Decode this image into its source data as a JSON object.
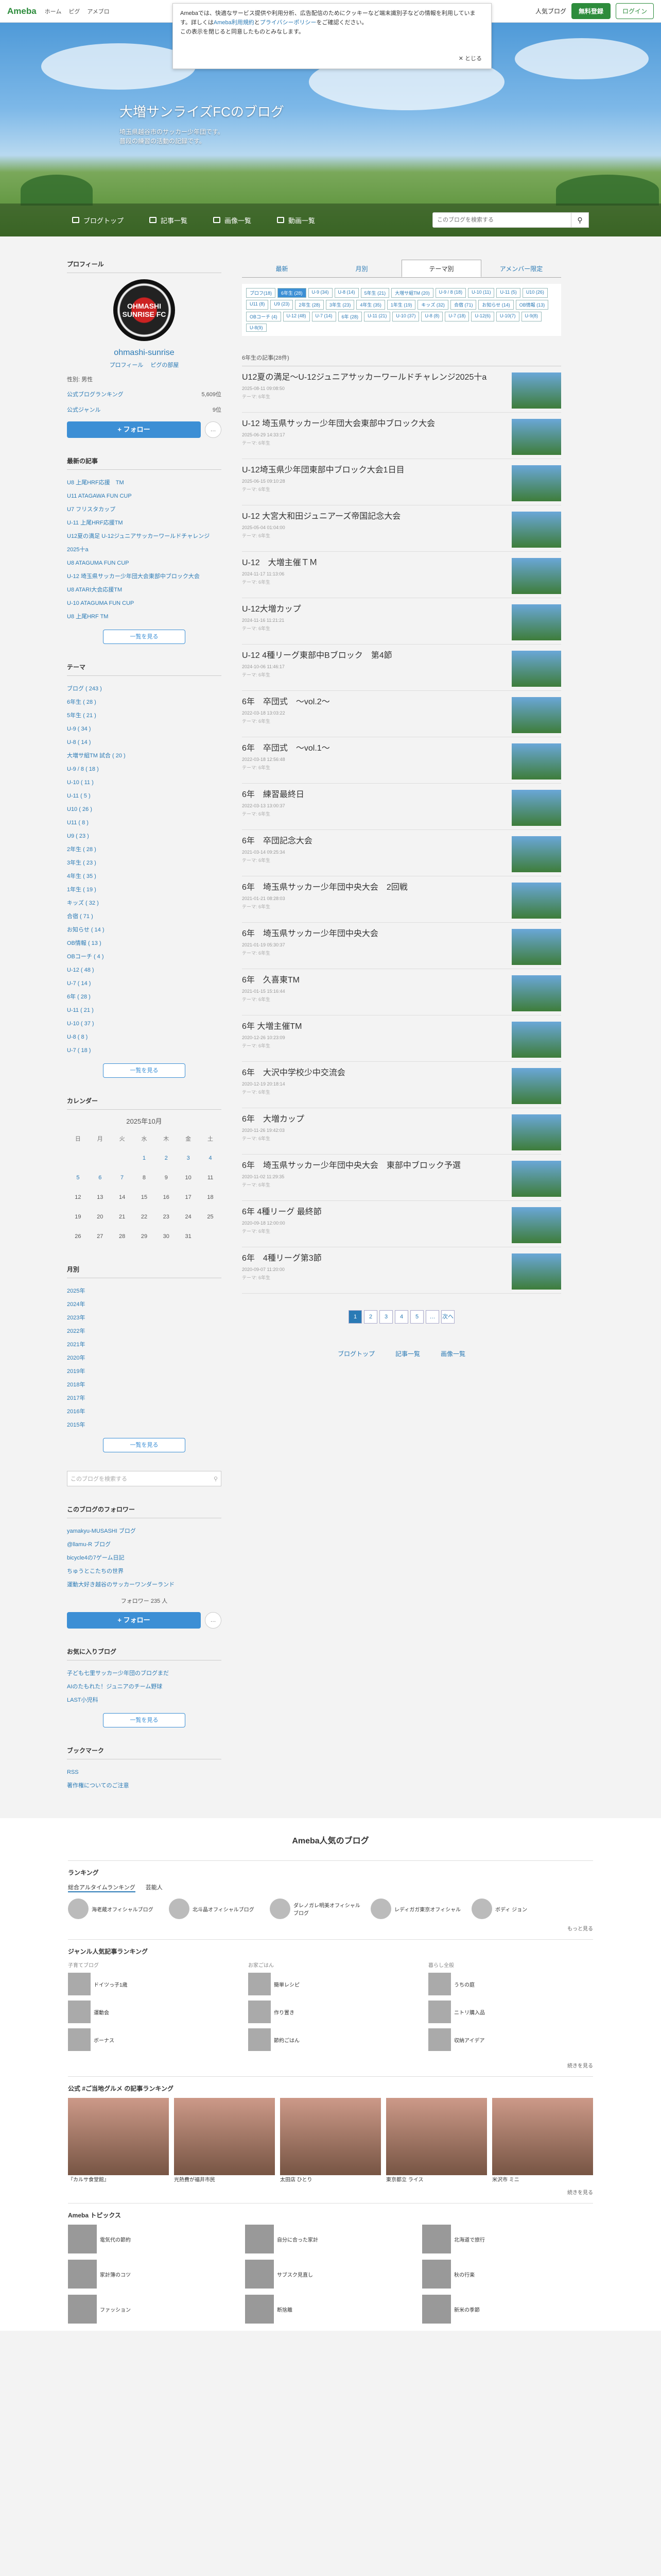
{
  "topbar": {
    "logo": "Ameba",
    "nav": [
      "ホーム",
      "ピグ",
      "アメブロ"
    ],
    "right_icon": "人気ブログ",
    "register": "無料登録",
    "login": "ログイン"
  },
  "notice": {
    "text1": "Amebaでは、快適なサービス提供や利用分析、広告配信のためにクッキーなど端末識別子などの情報を利用しています。詳しくは",
    "link1": "Ameba利用規約",
    "mid": "と",
    "link2": "プライバシーポリシー",
    "text2": "をご確認ください。",
    "text3": "この表示を閉じると同意したものとみなします。",
    "close": "✕ とじる"
  },
  "hero": {
    "title": "大増サンライズFCのブログ",
    "desc1": "埼玉県越谷市のサッカー少年団です。",
    "desc2": "普段の練習の活動の記録です。"
  },
  "gnav": {
    "items": [
      "ブログトップ",
      "記事一覧",
      "画像一覧",
      "動画一覧"
    ],
    "search_placeholder": "このブログを検索する"
  },
  "profile": {
    "title": "プロフィール",
    "avatar_text": "OHMASHI\nSUNRISE FC",
    "name": "ohmashi-sunrise",
    "link1": "プロフィール",
    "link2": "ピグの部屋",
    "info": "性別: 男性",
    "rank_label1": "公式ブログランキング",
    "rank_label2": "公式ジャンル",
    "rank_v1": "5,609位",
    "rank_v2": "9位",
    "follow": "+ フォロー"
  },
  "recent": {
    "title": "最新の記事",
    "items": [
      "U8 上尾HRF応援　TM",
      "U11 ATAGAWA FUN CUP",
      "U7 フリスタカップ",
      "U-11 上尾HRF応援TM",
      "U12夏の満足 U-12ジュニアサッカーワールドチャレンジ2025十a",
      "U8 ATAGUMA FUN CUP",
      "U-12 埼玉県サッカー少年団大会東部中ブロック大会",
      "U8 ATARI大会応援TM",
      "U-10 ATAGUMA FUN CUP",
      "U8 上尾HRF TM"
    ],
    "more": "一覧を見る"
  },
  "themes": {
    "title": "テーマ",
    "items": [
      "ブログ ( 243 )",
      "6年生 ( 28 )",
      "5年生 ( 21 )",
      "U-9 ( 34 )",
      "U-8 ( 14 )",
      "大増サ組TM 試合 ( 20 )",
      "U-9 / 8 ( 18 )",
      "U-10 ( 11 )",
      "U-11 ( 5 )",
      "U10 ( 26 )",
      "U11 ( 8 )",
      "U9 ( 23 )",
      "2年生 ( 28 )",
      "3年生 ( 23 )",
      "4年生 ( 35 )",
      "1年生 ( 19 )",
      "キッズ ( 32 )",
      "合宿 ( 71 )",
      "お知らせ ( 14 )",
      "OB情報 ( 13 )",
      "OBコーチ ( 4 )",
      "U-12 ( 48 )",
      "U-7 ( 14 )",
      "6年 ( 28 )",
      "U-11 ( 21 )",
      "U-10 ( 37 )",
      "U-8 ( 8 )",
      "U-7 ( 18 )"
    ],
    "more": "一覧を見る"
  },
  "calendar": {
    "title": "カレンダー",
    "month": "2025年10月",
    "week": [
      "日",
      "月",
      "火",
      "水",
      "木",
      "金",
      "土"
    ],
    "rows": [
      [
        "",
        "",
        "",
        "1",
        "2",
        "3",
        "4"
      ],
      [
        "5",
        "6",
        "7",
        "8",
        "9",
        "10",
        "11"
      ],
      [
        "12",
        "13",
        "14",
        "15",
        "16",
        "17",
        "18"
      ],
      [
        "19",
        "20",
        "21",
        "22",
        "23",
        "24",
        "25"
      ],
      [
        "26",
        "27",
        "28",
        "29",
        "30",
        "31",
        ""
      ]
    ]
  },
  "archive": {
    "title": "月別",
    "items": [
      "2025年",
      "2024年",
      "2023年",
      "2022年",
      "2021年",
      "2020年",
      "2019年",
      "2018年",
      "2017年",
      "2016年",
      "2015年"
    ],
    "more": "一覧を見る"
  },
  "search": {
    "placeholder": "このブログを検索する"
  },
  "following": {
    "title": "このブログのフォロワー",
    "items": [
      "yamakyu-MUSASHI ブログ",
      "@llamu-R ブログ",
      "bicycle4の7ゲーム日記",
      "ちゅうとこたちの世界",
      "運動大好き越谷のサッカーワンダーランド"
    ],
    "count": "フォロワー 235 人",
    "follow": "+ フォロー"
  },
  "favorite": {
    "title": "お気に入りブログ",
    "items": [
      "子ども七里サッカー少年団のブログまだ",
      "AIのたもれた！ジュニアのチーム野球",
      "LAST小児科"
    ],
    "more": "一覧を見る"
  },
  "bookmark": {
    "title": "ブックマーク",
    "items": [
      "RSS",
      "著作権についてのご注意"
    ]
  },
  "tabs": {
    "items": [
      "最新",
      "月別",
      "テーマ別",
      "アメンバー限定"
    ],
    "active": 2
  },
  "tags": [
    "プロフ(18)",
    "6年生 (28)",
    "U-9 (34)",
    "U-8 (14)",
    "5年生 (21)",
    "大増サ組TM (20)",
    "U-9 / 8 (18)",
    "U-10 (11)",
    "U-11 (5)",
    "U10 (26)",
    "U11 (8)",
    "U9 (23)",
    "2年生 (28)",
    "3年生 (23)",
    "4年生 (35)",
    "1年生 (19)",
    "キッズ (32)",
    "合宿 (71)",
    "お知らせ (14)",
    "OB情報 (13)",
    "OBコーチ (4)",
    "U-12 (48)",
    "U-7 (14)",
    "6年 (28)",
    "U-11 (21)",
    "U-10 (37)",
    "U-8 (8)",
    "U-7 (18)",
    "U-12(6)",
    "U-10(7)",
    "U-9(8)",
    "U-8(9)"
  ],
  "count": "6年生の記事(28件)",
  "entries": [
    {
      "title": "U12夏の満足～U-12ジュニアサッカーワールドチャレンジ2025十a",
      "meta": "2025-08-11 09:08:50",
      "theme": "テーマ: 6年生"
    },
    {
      "title": "U-12 埼玉県サッカー少年団大会東部中ブロック大会",
      "meta": "2025-06-29 14:33:17",
      "theme": "テーマ: 6年生"
    },
    {
      "title": "U-12埼玉県少年団東部中ブロック大会1日目",
      "meta": "2025-06-15 09:10:28",
      "theme": "テーマ: 6年生"
    },
    {
      "title": "U-12 大宮大和田ジュニアーズ帝国記念大会",
      "meta": "2025-05-04 01:04:00",
      "theme": "テーマ: 6年生"
    },
    {
      "title": "U-12　大増主催ＴＭ",
      "meta": "2024-11-17 11:13:06",
      "theme": "テーマ: 6年生"
    },
    {
      "title": "U-12大増カップ",
      "meta": "2024-11-16 11:21:21",
      "theme": "テーマ: 6年生"
    },
    {
      "title": "U-12 4種リーグ東部中Bブロック　第4節",
      "meta": "2024-10-06 11:46:17",
      "theme": "テーマ: 6年生"
    },
    {
      "title": "6年　卒団式　～vol.2～",
      "meta": "2022-03-18 13:03:22",
      "theme": "テーマ: 6年生"
    },
    {
      "title": "6年　卒団式　～vol.1～",
      "meta": "2022-03-18 12:56:48",
      "theme": "テーマ: 6年生"
    },
    {
      "title": "6年　練習最終日",
      "meta": "2022-03-13 13:00:37",
      "theme": "テーマ: 6年生"
    },
    {
      "title": "6年　卒団記念大会",
      "meta": "2021-03-14 09:25:34",
      "theme": "テーマ: 6年生"
    },
    {
      "title": "6年　埼玉県サッカー少年団中央大会　2回戦",
      "meta": "2021-01-21 08:28:03",
      "theme": "テーマ: 6年生"
    },
    {
      "title": "6年　埼玉県サッカー少年団中央大会",
      "meta": "2021-01-19 05:30:37",
      "theme": "テーマ: 6年生"
    },
    {
      "title": "6年　久喜東TM",
      "meta": "2021-01-15 15:16:44",
      "theme": "テーマ: 6年生"
    },
    {
      "title": "6年 大増主催TM",
      "meta": "2020-12-26 10:23:09",
      "theme": "テーマ: 6年生"
    },
    {
      "title": "6年　大沢中学校少中交流会",
      "meta": "2020-12-19 20:18:14",
      "theme": "テーマ: 6年生"
    },
    {
      "title": "6年　大増カップ",
      "meta": "2020-11-26 19:42:03",
      "theme": "テーマ: 6年生"
    },
    {
      "title": "6年　埼玉県サッカー少年団中央大会　東部中ブロック予選",
      "meta": "2020-11-02 11:29:35",
      "theme": "テーマ: 6年生"
    },
    {
      "title": "6年 4種リーグ 最終節",
      "meta": "2020-09-18 12:00:00",
      "theme": "テーマ: 6年生"
    },
    {
      "title": "6年　4種リーグ第3節",
      "meta": "2020-09-07 11:20:00",
      "theme": "テーマ: 6年生"
    }
  ],
  "pager": [
    "1",
    "2",
    "3",
    "4",
    "5",
    "…",
    "次へ"
  ],
  "bottom_nav": [
    "ブログトップ",
    "記事一覧",
    "画像一覧"
  ],
  "popular": {
    "title": "Ameba人気のブログ",
    "rank_title": "ランキング",
    "rank_tabs": [
      "総合アルタイムランキング",
      "芸能人"
    ],
    "rank_items": [
      "海老蔵オフィシャルブログ",
      "北斗晶オフィシャルブログ",
      "ダレノガレ明美オフィシャルブログ",
      "レディガガ東京オフィシャル",
      "ボディ ジョン"
    ],
    "rank_more": "もっと見る",
    "genre_title": "ジャンル人気記事ランキング",
    "genres": [
      {
        "head": "子育てブログ",
        "items": [
          "ドイツっ子1歳",
          "運動会",
          "ボーナス"
        ]
      },
      {
        "head": "お家ごはん",
        "items": [
          "簡単レシピ",
          "作り置き",
          "節約ごはん"
        ]
      },
      {
        "head": "暮らし全般",
        "items": [
          "うちの庭",
          "ニトリ購入品",
          "収納アイデア"
        ]
      }
    ],
    "genre_more": "続きを見る",
    "gourmet_title": "公式 #ご当地グルメ の記事ランキング",
    "gourmet": [
      "『カルサ食堂館』",
      "光熱費が福井市民",
      "太田店 ひとり",
      "東京都立 ライス",
      "米沢市 ミニ"
    ],
    "gourmet_more": "続きを見る",
    "topics_title": "Ameba トピックス",
    "topics": [
      "電気代の節約",
      "自分に合った家計",
      "北海道で旅行",
      "家計簿のコツ",
      "サブスク見直し",
      "秋の行楽",
      "ファッション",
      "断捨離",
      "新米の季節"
    ]
  }
}
